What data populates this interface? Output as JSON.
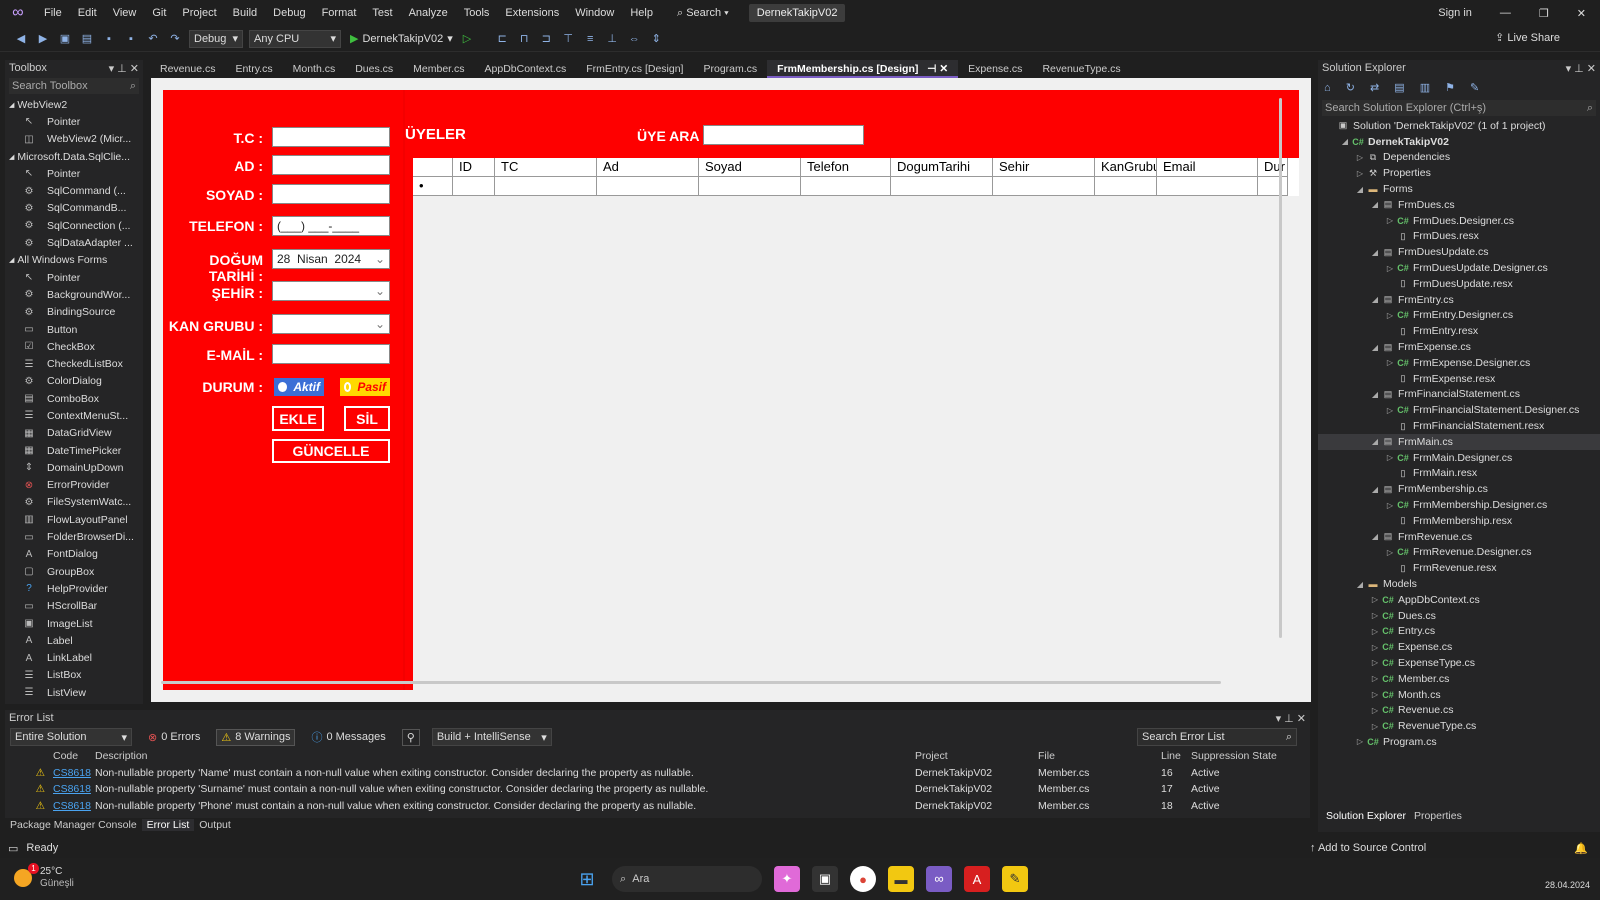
{
  "menu": [
    "File",
    "Edit",
    "View",
    "Git",
    "Project",
    "Build",
    "Debug",
    "Format",
    "Test",
    "Analyze",
    "Tools",
    "Extensions",
    "Window",
    "Help"
  ],
  "search_label": "Search",
  "solution_badge": "DernekTakipV02",
  "sign_in": "Sign in",
  "live_share": "Live Share",
  "toolbar": {
    "config": "Debug",
    "platform": "Any CPU",
    "run_target": "DernekTakipV02"
  },
  "toolbox": {
    "title": "Toolbox",
    "search_placeholder": "Search Toolbox",
    "items": [
      {
        "type": "group",
        "label": "WebView2"
      },
      {
        "type": "item",
        "label": "Pointer",
        "icon": "pointer-icon"
      },
      {
        "type": "item",
        "label": "WebView2 (Micr...",
        "icon": "webview-icon"
      },
      {
        "type": "group",
        "label": "Microsoft.Data.SqlClie..."
      },
      {
        "type": "item",
        "label": "Pointer",
        "icon": "pointer-icon"
      },
      {
        "type": "item",
        "label": "SqlCommand (...",
        "icon": "component-icon"
      },
      {
        "type": "item",
        "label": "SqlCommandB...",
        "icon": "component-icon"
      },
      {
        "type": "item",
        "label": "SqlConnection (...",
        "icon": "component-icon"
      },
      {
        "type": "item",
        "label": "SqlDataAdapter ...",
        "icon": "component-icon"
      },
      {
        "type": "group",
        "label": "All Windows Forms"
      },
      {
        "type": "item",
        "label": "Pointer",
        "icon": "pointer-icon"
      },
      {
        "type": "item",
        "label": "BackgroundWor...",
        "icon": "component-icon"
      },
      {
        "type": "item",
        "label": "BindingSource",
        "icon": "component-icon"
      },
      {
        "type": "item",
        "label": "Button",
        "icon": "button-icon"
      },
      {
        "type": "item",
        "label": "CheckBox",
        "icon": "checkbox-icon"
      },
      {
        "type": "item",
        "label": "CheckedListBox",
        "icon": "list-icon"
      },
      {
        "type": "item",
        "label": "ColorDialog",
        "icon": "component-icon"
      },
      {
        "type": "item",
        "label": "ComboBox",
        "icon": "combobox-icon"
      },
      {
        "type": "item",
        "label": "ContextMenuSt...",
        "icon": "menu-icon"
      },
      {
        "type": "item",
        "label": "DataGridView",
        "icon": "grid-icon"
      },
      {
        "type": "item",
        "label": "DateTimePicker",
        "icon": "calendar-icon"
      },
      {
        "type": "item",
        "label": "DomainUpDown",
        "icon": "updown-icon"
      },
      {
        "type": "item",
        "label": "ErrorProvider",
        "icon": "error-icon"
      },
      {
        "type": "item",
        "label": "FileSystemWatc...",
        "icon": "component-icon"
      },
      {
        "type": "item",
        "label": "FlowLayoutPanel",
        "icon": "panel-icon"
      },
      {
        "type": "item",
        "label": "FolderBrowserDi...",
        "icon": "folder-icon"
      },
      {
        "type": "item",
        "label": "FontDialog",
        "icon": "font-icon"
      },
      {
        "type": "item",
        "label": "GroupBox",
        "icon": "groupbox-icon"
      },
      {
        "type": "item",
        "label": "HelpProvider",
        "icon": "help-icon"
      },
      {
        "type": "item",
        "label": "HScrollBar",
        "icon": "scrollbar-icon"
      },
      {
        "type": "item",
        "label": "ImageList",
        "icon": "image-icon"
      },
      {
        "type": "item",
        "label": "Label",
        "icon": "label-icon"
      },
      {
        "type": "item",
        "label": "LinkLabel",
        "icon": "label-icon"
      },
      {
        "type": "item",
        "label": "ListBox",
        "icon": "list-icon"
      },
      {
        "type": "item",
        "label": "ListView",
        "icon": "list-icon"
      }
    ]
  },
  "tabs": [
    {
      "label": "Revenue.cs"
    },
    {
      "label": "Entry.cs"
    },
    {
      "label": "Month.cs"
    },
    {
      "label": "Dues.cs"
    },
    {
      "label": "Member.cs"
    },
    {
      "label": "AppDbContext.cs"
    },
    {
      "label": "FrmEntry.cs [Design]"
    },
    {
      "label": "Program.cs"
    },
    {
      "label": "FrmMembership.cs [Design]",
      "active": true
    },
    {
      "label": "Expense.cs"
    },
    {
      "label": "RevenueType.cs"
    }
  ],
  "form": {
    "labels": {
      "tc": "T.C :",
      "ad": "AD :",
      "soyad": "SOYAD :",
      "telefon": "TELEFON :",
      "dogum": "DOĞUM TARİHİ :",
      "sehir": "ŞEHİR :",
      "kan": "KAN GRUBU :",
      "email": "E-MAİL :",
      "durum": "DURUM :"
    },
    "phone_mask": "(___) ___-____",
    "date": {
      "day": "28",
      "month": "Nisan",
      "year": "2024"
    },
    "radio_active": "Aktif",
    "radio_passive": "Pasif",
    "btn_add": "EKLE",
    "btn_delete": "SİL",
    "btn_update": "GÜNCELLE",
    "members_title": "ÜYELER",
    "search_label": "ÜYE ARA",
    "grid_columns": [
      "ID",
      "TC",
      "Ad",
      "Soyad",
      "Telefon",
      "DogumTarihi",
      "Sehir",
      "KanGrubu",
      "Email",
      "Dur"
    ],
    "new_row_marker": "•"
  },
  "solution": {
    "title": "Solution Explorer",
    "search_placeholder": "Search Solution Explorer (Ctrl+ş)",
    "items": [
      {
        "label": "Solution 'DernekTakipV02' (1 of 1 project)",
        "depth": 0,
        "arrow": "",
        "icon": "solution-icon",
        "kind": "fm"
      },
      {
        "label": "DernekTakipV02",
        "depth": 1,
        "arrow": "◢",
        "icon": "project-icon",
        "kind": "fm",
        "bold": true
      },
      {
        "label": "Dependencies",
        "depth": 2,
        "arrow": "▷",
        "icon": "dependencies-icon",
        "kind": "fm"
      },
      {
        "label": "Properties",
        "depth": 2,
        "arrow": "▷",
        "icon": "properties-icon",
        "kind": "fm"
      },
      {
        "label": "Forms",
        "depth": 2,
        "arrow": "◢",
        "icon": "folder-icon",
        "kind": "fd"
      },
      {
        "label": "FrmDues.cs",
        "depth": 3,
        "arrow": "◢",
        "icon": "form-icon",
        "kind": "fm"
      },
      {
        "label": "FrmDues.Designer.cs",
        "depth": 4,
        "arrow": "▷",
        "icon": "csharp-icon",
        "kind": "cs"
      },
      {
        "label": "FrmDues.resx",
        "depth": 4,
        "arrow": "",
        "icon": "resx-icon",
        "kind": "rx"
      },
      {
        "label": "FrmDuesUpdate.cs",
        "depth": 3,
        "arrow": "◢",
        "icon": "form-icon",
        "kind": "fm"
      },
      {
        "label": "FrmDuesUpdate.Designer.cs",
        "depth": 4,
        "arrow": "▷",
        "icon": "csharp-icon",
        "kind": "cs"
      },
      {
        "label": "FrmDuesUpdate.resx",
        "depth": 4,
        "arrow": "",
        "icon": "resx-icon",
        "kind": "rx"
      },
      {
        "label": "FrmEntry.cs",
        "depth": 3,
        "arrow": "◢",
        "icon": "form-icon",
        "kind": "fm"
      },
      {
        "label": "FrmEntry.Designer.cs",
        "depth": 4,
        "arrow": "▷",
        "icon": "csharp-icon",
        "kind": "cs"
      },
      {
        "label": "FrmEntry.resx",
        "depth": 4,
        "arrow": "",
        "icon": "resx-icon",
        "kind": "rx"
      },
      {
        "label": "FrmExpense.cs",
        "depth": 3,
        "arrow": "◢",
        "icon": "form-icon",
        "kind": "fm"
      },
      {
        "label": "FrmExpense.Designer.cs",
        "depth": 4,
        "arrow": "▷",
        "icon": "csharp-icon",
        "kind": "cs"
      },
      {
        "label": "FrmExpense.resx",
        "depth": 4,
        "arrow": "",
        "icon": "resx-icon",
        "kind": "rx"
      },
      {
        "label": "FrmFinancialStatement.cs",
        "depth": 3,
        "arrow": "◢",
        "icon": "form-icon",
        "kind": "fm"
      },
      {
        "label": "FrmFinancialStatement.Designer.cs",
        "depth": 4,
        "arrow": "▷",
        "icon": "csharp-icon",
        "kind": "cs"
      },
      {
        "label": "FrmFinancialStatement.resx",
        "depth": 4,
        "arrow": "",
        "icon": "resx-icon",
        "kind": "rx"
      },
      {
        "label": "FrmMain.cs",
        "depth": 3,
        "arrow": "◢",
        "icon": "form-icon",
        "kind": "fm",
        "sel": true
      },
      {
        "label": "FrmMain.Designer.cs",
        "depth": 4,
        "arrow": "▷",
        "icon": "csharp-icon",
        "kind": "cs"
      },
      {
        "label": "FrmMain.resx",
        "depth": 4,
        "arrow": "",
        "icon": "resx-icon",
        "kind": "rx"
      },
      {
        "label": "FrmMembership.cs",
        "depth": 3,
        "arrow": "◢",
        "icon": "form-icon",
        "kind": "fm"
      },
      {
        "label": "FrmMembership.Designer.cs",
        "depth": 4,
        "arrow": "▷",
        "icon": "csharp-icon",
        "kind": "cs"
      },
      {
        "label": "FrmMembership.resx",
        "depth": 4,
        "arrow": "",
        "icon": "resx-icon",
        "kind": "rx"
      },
      {
        "label": "FrmRevenue.cs",
        "depth": 3,
        "arrow": "◢",
        "icon": "form-icon",
        "kind": "fm"
      },
      {
        "label": "FrmRevenue.Designer.cs",
        "depth": 4,
        "arrow": "▷",
        "icon": "csharp-icon",
        "kind": "cs"
      },
      {
        "label": "FrmRevenue.resx",
        "depth": 4,
        "arrow": "",
        "icon": "resx-icon",
        "kind": "rx"
      },
      {
        "label": "Models",
        "depth": 2,
        "arrow": "◢",
        "icon": "folder-icon",
        "kind": "fd"
      },
      {
        "label": "AppDbContext.cs",
        "depth": 3,
        "arrow": "▷",
        "icon": "csharp-icon",
        "kind": "cs"
      },
      {
        "label": "Dues.cs",
        "depth": 3,
        "arrow": "▷",
        "icon": "csharp-icon",
        "kind": "cs"
      },
      {
        "label": "Entry.cs",
        "depth": 3,
        "arrow": "▷",
        "icon": "csharp-icon",
        "kind": "cs"
      },
      {
        "label": "Expense.cs",
        "depth": 3,
        "arrow": "▷",
        "icon": "csharp-icon",
        "kind": "cs"
      },
      {
        "label": "ExpenseType.cs",
        "depth": 3,
        "arrow": "▷",
        "icon": "csharp-icon",
        "kind": "cs"
      },
      {
        "label": "Member.cs",
        "depth": 3,
        "arrow": "▷",
        "icon": "csharp-icon",
        "kind": "cs"
      },
      {
        "label": "Month.cs",
        "depth": 3,
        "arrow": "▷",
        "icon": "csharp-icon",
        "kind": "cs"
      },
      {
        "label": "Revenue.cs",
        "depth": 3,
        "arrow": "▷",
        "icon": "csharp-icon",
        "kind": "cs"
      },
      {
        "label": "RevenueType.cs",
        "depth": 3,
        "arrow": "▷",
        "icon": "csharp-icon",
        "kind": "cs"
      },
      {
        "label": "Program.cs",
        "depth": 2,
        "arrow": "▷",
        "icon": "csharp-icon",
        "kind": "cs"
      }
    ],
    "bottom_tabs": [
      "Solution Explorer",
      "Properties"
    ]
  },
  "errors": {
    "title": "Error List",
    "scope": "Entire Solution",
    "errors_count": "0 Errors",
    "warnings_count": "8 Warnings",
    "messages_count": "0 Messages",
    "build_filter": "Build + IntelliSense",
    "search_placeholder": "Search Error List",
    "columns": [
      "Code",
      "Description",
      "Project",
      "File",
      "Line",
      "Suppression State"
    ],
    "rows": [
      {
        "code": "CS8618",
        "desc": "Non-nullable property 'Name' must contain a non-null value when exiting constructor. Consider declaring the property as nullable.",
        "project": "DernekTakipV02",
        "file": "Member.cs",
        "line": "16",
        "state": "Active"
      },
      {
        "code": "CS8618",
        "desc": "Non-nullable property 'Surname' must contain a non-null value when exiting constructor. Consider declaring the property as nullable.",
        "project": "DernekTakipV02",
        "file": "Member.cs",
        "line": "17",
        "state": "Active"
      },
      {
        "code": "CS8618",
        "desc": "Non-nullable property 'Phone' must contain a non-null value when exiting constructor. Consider declaring the property as nullable.",
        "project": "DernekTakipV02",
        "file": "Member.cs",
        "line": "18",
        "state": "Active"
      }
    ],
    "bottom_tabs": [
      "Package Manager Console",
      "Error List",
      "Output"
    ]
  },
  "status": {
    "ready": "Ready",
    "source_control": "Add to Source Control"
  },
  "taskbar": {
    "temp": "25°C",
    "weather": "Güneşli",
    "search": "Ara",
    "date": "28.04.2024",
    "notification_count": "1"
  },
  "colors": {
    "form_bg": "#fe0000",
    "accent": "#7a5cc4",
    "ide_bg": "#1f1f1f"
  }
}
